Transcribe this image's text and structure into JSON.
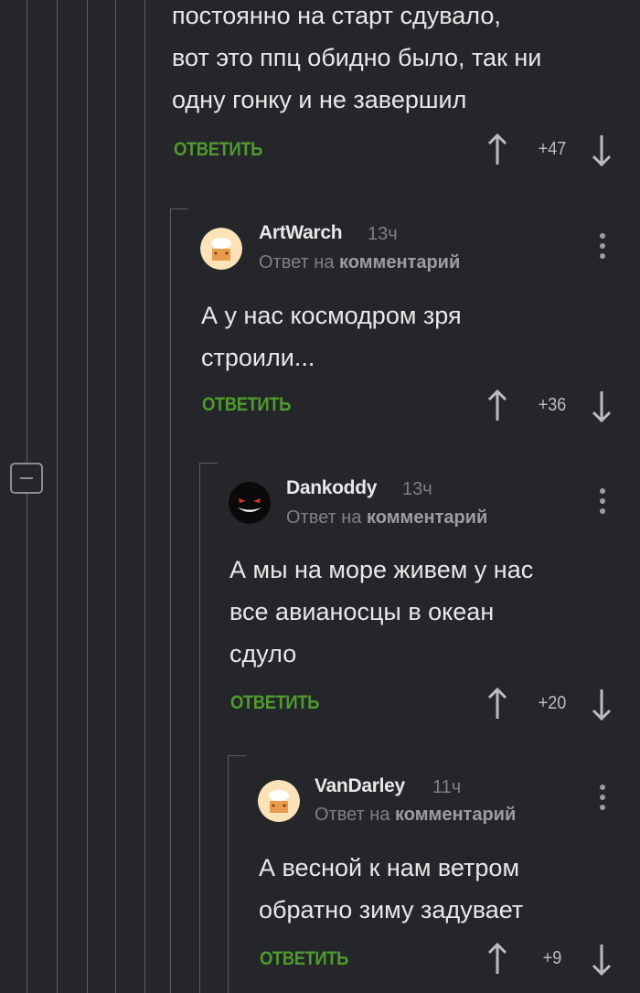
{
  "comments": [
    {
      "text_lines": [
        "постоянно на старт сдувало,",
        "вот это ппц обидно было, так ни",
        "одну гонку и не завершил"
      ],
      "reply_label": "ОТВЕТИТЬ",
      "score": "+47"
    },
    {
      "author": "ArtWarch",
      "time": "13ч",
      "reply_prefix": "Ответ на",
      "reply_target": "комментарий",
      "text_lines": [
        "А у нас космодром зря",
        "строили..."
      ],
      "reply_label": "ОТВЕТИТЬ",
      "score": "+36"
    },
    {
      "author": "Dankoddy",
      "time": "13ч",
      "reply_prefix": "Ответ на",
      "reply_target": "комментарий",
      "text_lines": [
        "А мы на море живем у нас",
        "все авианосцы в океан",
        "сдуло"
      ],
      "reply_label": "ОТВЕТИТЬ",
      "score": "+20"
    },
    {
      "author": "VanDarley",
      "time": "11ч",
      "reply_prefix": "Ответ на",
      "reply_target": "комментарий",
      "text_lines": [
        "А весной к нам ветром",
        "обратно зиму задувает"
      ],
      "reply_label": "ОТВЕТИТЬ",
      "score": "+9"
    }
  ],
  "colors": {
    "background": "#24262a",
    "reply_green": "#4f9a2d",
    "thread_line": "#5a5d62",
    "muted_text": "#7d8085"
  }
}
